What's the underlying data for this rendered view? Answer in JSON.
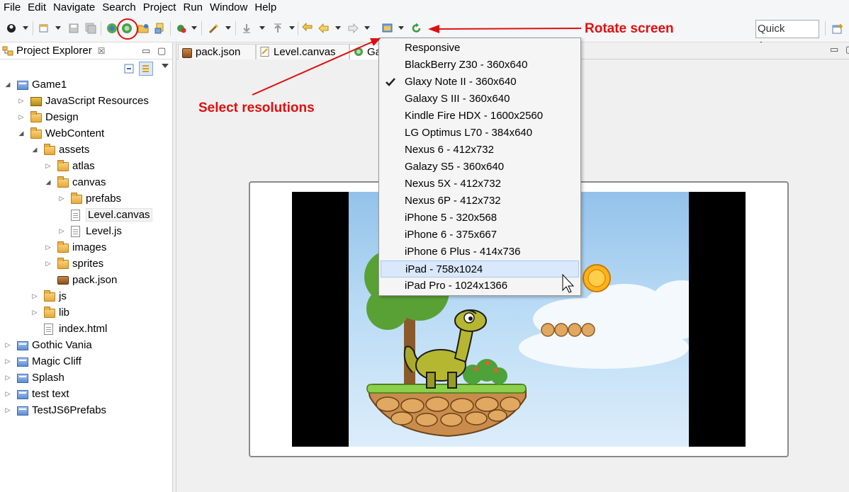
{
  "menu": [
    "File",
    "Edit",
    "Navigate",
    "Search",
    "Project",
    "Run",
    "Window",
    "Help"
  ],
  "toolbar": {
    "quick_access_placeholder": "Quick Access"
  },
  "explorer": {
    "title": "Project Explorer",
    "close_glyph": "☒",
    "tree": [
      {
        "label": "Game1",
        "depth": 0,
        "expanded": true,
        "icon": "project-icon"
      },
      {
        "label": "JavaScript Resources",
        "depth": 1,
        "expanded": false,
        "icon": "js-resources-icon"
      },
      {
        "label": "Design",
        "depth": 1,
        "expanded": false,
        "icon": "folder-icon"
      },
      {
        "label": "WebContent",
        "depth": 1,
        "expanded": true,
        "icon": "folder-icon"
      },
      {
        "label": "assets",
        "depth": 2,
        "expanded": true,
        "icon": "folder-icon"
      },
      {
        "label": "atlas",
        "depth": 3,
        "expanded": false,
        "icon": "folder-icon"
      },
      {
        "label": "canvas",
        "depth": 3,
        "expanded": true,
        "icon": "folder-icon"
      },
      {
        "label": "prefabs",
        "depth": 4,
        "expanded": false,
        "icon": "folder-icon"
      },
      {
        "label": "Level.canvas",
        "depth": 4,
        "leaf": true,
        "icon": "canvas-file-icon",
        "selected": true
      },
      {
        "label": "Level.js",
        "depth": 4,
        "expanded": false,
        "icon": "js-file-icon"
      },
      {
        "label": "images",
        "depth": 3,
        "expanded": false,
        "icon": "folder-icon"
      },
      {
        "label": "sprites",
        "depth": 3,
        "expanded": false,
        "icon": "folder-icon"
      },
      {
        "label": "pack.json",
        "depth": 3,
        "leaf": true,
        "icon": "pack-file-icon"
      },
      {
        "label": "js",
        "depth": 2,
        "expanded": false,
        "icon": "folder-icon"
      },
      {
        "label": "lib",
        "depth": 2,
        "expanded": false,
        "icon": "folder-icon"
      },
      {
        "label": "index.html",
        "depth": 2,
        "leaf": true,
        "icon": "html-file-icon"
      },
      {
        "label": "Gothic Vania",
        "depth": 0,
        "expanded": false,
        "icon": "project-icon"
      },
      {
        "label": "Magic Cliff",
        "depth": 0,
        "expanded": false,
        "icon": "project-icon"
      },
      {
        "label": "Splash",
        "depth": 0,
        "expanded": false,
        "icon": "project-icon"
      },
      {
        "label": "test text",
        "depth": 0,
        "expanded": false,
        "icon": "project-icon"
      },
      {
        "label": "TestJS6Prefabs",
        "depth": 0,
        "expanded": false,
        "icon": "project-icon"
      }
    ]
  },
  "editor_tabs": [
    {
      "label": "pack.json",
      "icon": "pack-file-icon"
    },
    {
      "label": "Level.canvas",
      "icon": "canvas-file-icon"
    },
    {
      "label": "Ga",
      "icon": "game-preview-icon",
      "active": true
    }
  ],
  "resolutions": {
    "items": [
      {
        "label": "Responsive"
      },
      {
        "label": "BlackBerry Z30 - 360x640"
      },
      {
        "label": "Glaxy Note II - 360x640",
        "checked": true
      },
      {
        "label": "Galaxy S III - 360x640"
      },
      {
        "label": "Kindle Fire HDX - 1600x2560"
      },
      {
        "label": "LG Optimus L70 - 384x640"
      },
      {
        "label": "Nexus 6 - 412x732"
      },
      {
        "label": "Galazy S5 - 360x640"
      },
      {
        "label": "Nexus 5X - 412x732"
      },
      {
        "label": "Nexus 6P - 412x732"
      },
      {
        "label": "iPhone 5 - 320x568"
      },
      {
        "label": "iPhone 6 - 375x667"
      },
      {
        "label": "iPhone 6 Plus - 414x736"
      },
      {
        "label": "iPad - 758x1024",
        "hovered": true
      },
      {
        "label": "iPad Pro - 1024x1366"
      }
    ]
  },
  "annotations": {
    "rotate": "Rotate screen",
    "select": "Select resolutions",
    "color": "#e00f0f"
  }
}
